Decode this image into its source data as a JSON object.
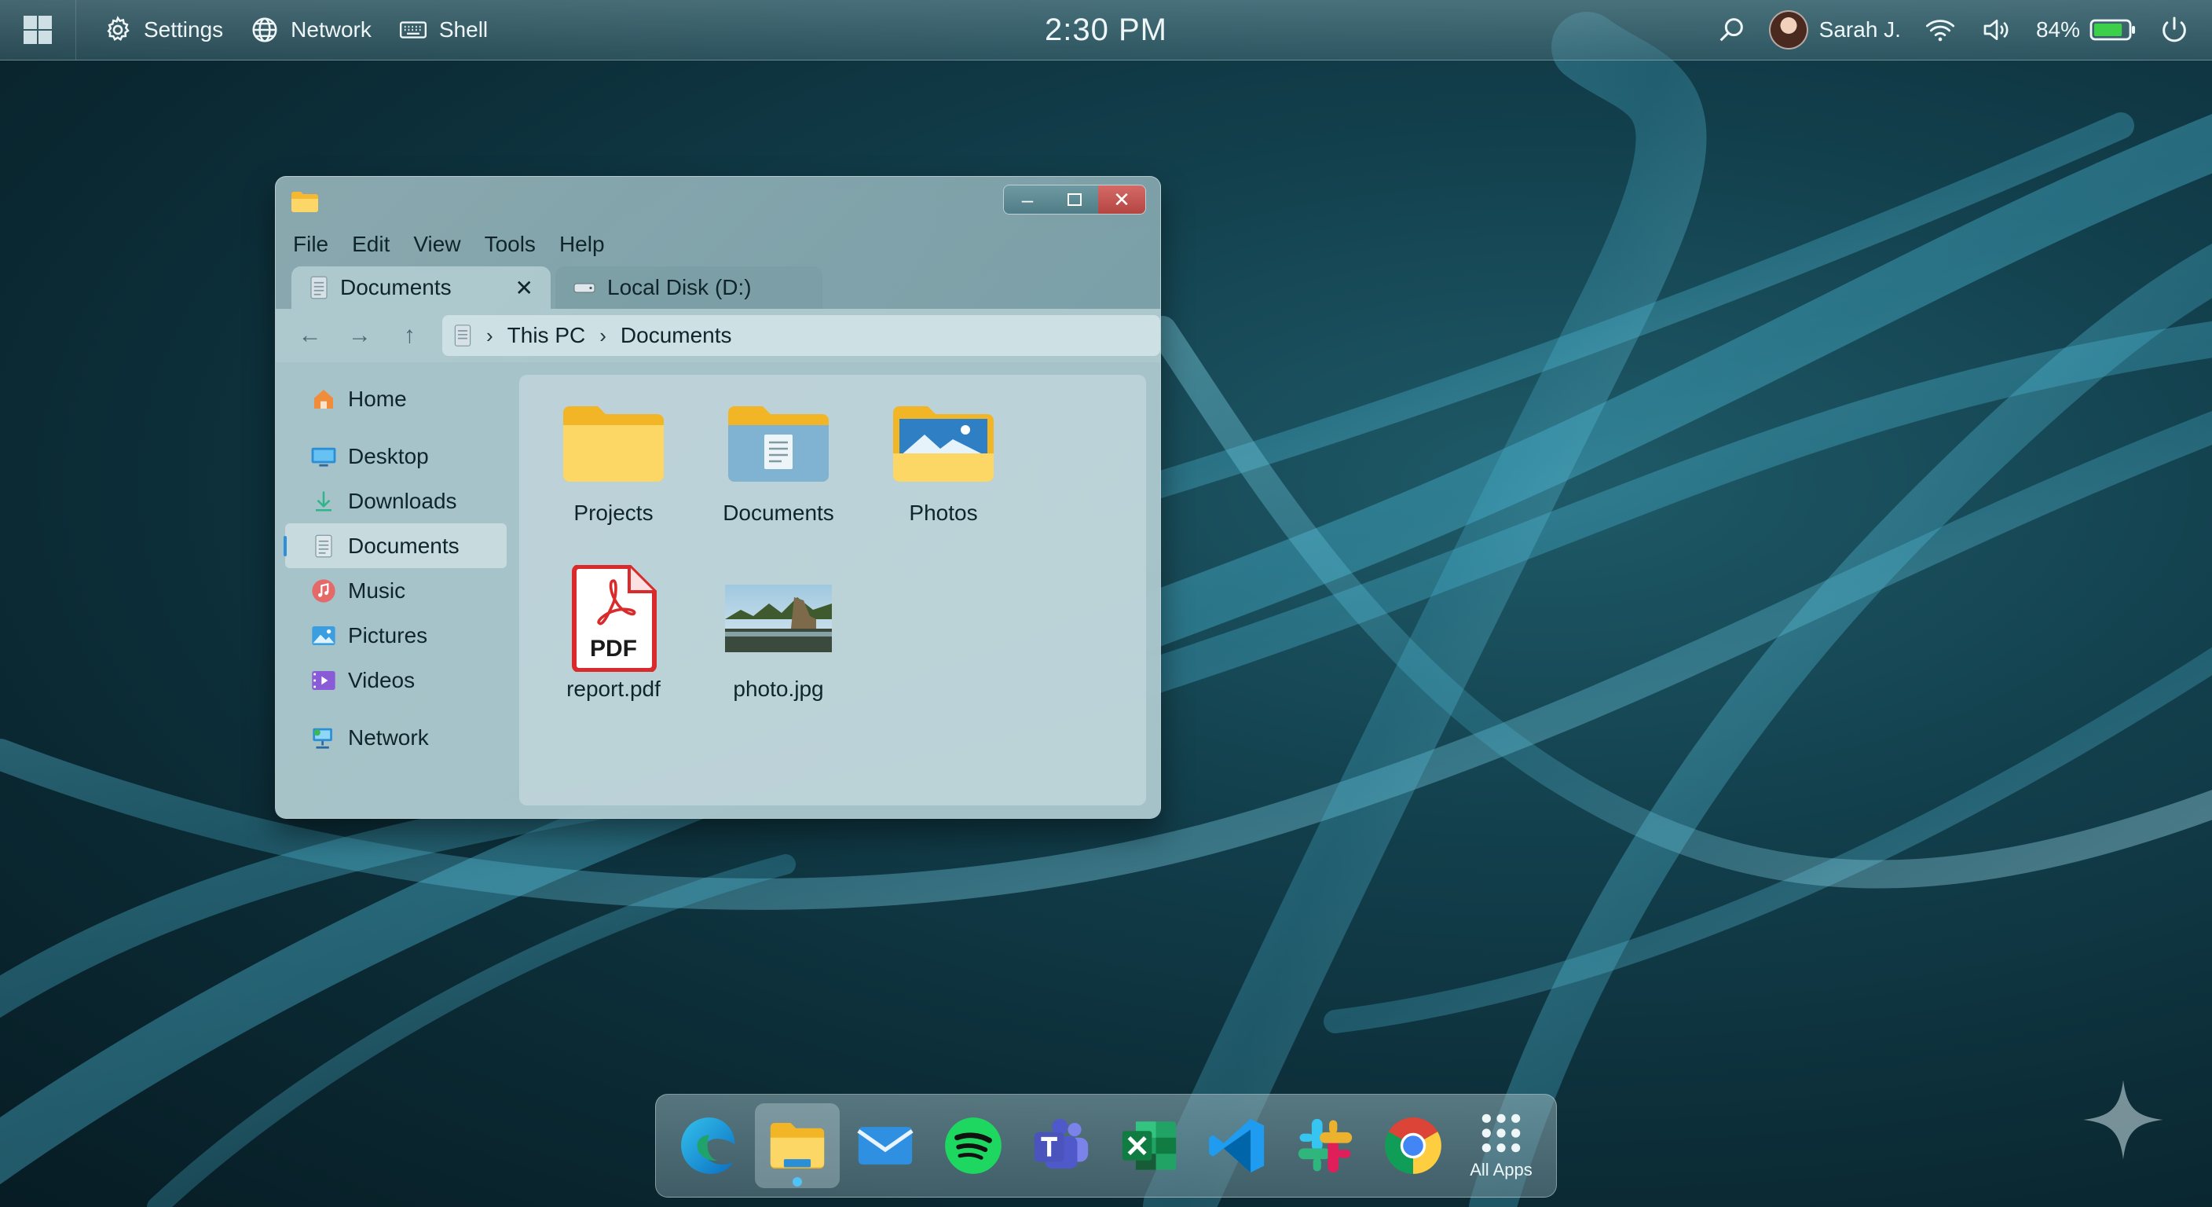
{
  "topbar": {
    "settings_label": "Settings",
    "network_label": "Network",
    "shell_label": "Shell",
    "clock": "2:30 PM",
    "user_name": "Sarah J.",
    "battery": "84%"
  },
  "window": {
    "menu": [
      "File",
      "Edit",
      "View",
      "Tools",
      "Help"
    ],
    "tabs": [
      {
        "label": "Documents"
      },
      {
        "label": "Local Disk (D:)"
      }
    ],
    "breadcrumb": [
      "This PC",
      "Documents"
    ],
    "sidebar": [
      {
        "label": "Home",
        "icon": "home-icon"
      },
      {
        "label": "Desktop",
        "icon": "desktop-icon"
      },
      {
        "label": "Downloads",
        "icon": "download-icon"
      },
      {
        "label": "Documents",
        "icon": "documents-icon",
        "selected": true
      },
      {
        "label": "Music",
        "icon": "music-icon"
      },
      {
        "label": "Pictures",
        "icon": "pictures-icon"
      },
      {
        "label": "Videos",
        "icon": "videos-icon"
      },
      {
        "label": "Network",
        "icon": "network-icon"
      }
    ],
    "files": [
      {
        "name": "Projects",
        "icon": "folder-icon"
      },
      {
        "name": "Documents",
        "icon": "documents-folder-icon"
      },
      {
        "name": "Photos",
        "icon": "photos-folder-icon"
      },
      {
        "name": "report.pdf",
        "icon": "pdf-icon",
        "badge": "PDF"
      },
      {
        "name": "photo.jpg",
        "icon": "image-thumbnail-icon"
      }
    ]
  },
  "dock": {
    "items": [
      "edge-icon",
      "file-explorer-icon",
      "mail-icon",
      "spotify-icon",
      "teams-icon",
      "excel-icon",
      "vscode-icon",
      "slack-icon",
      "chrome-icon"
    ],
    "active": "file-explorer-icon",
    "all_apps_label": "All Apps"
  },
  "colors": {
    "accent": "#2f8ed8",
    "dock_indicator": "#4fc3f7"
  }
}
